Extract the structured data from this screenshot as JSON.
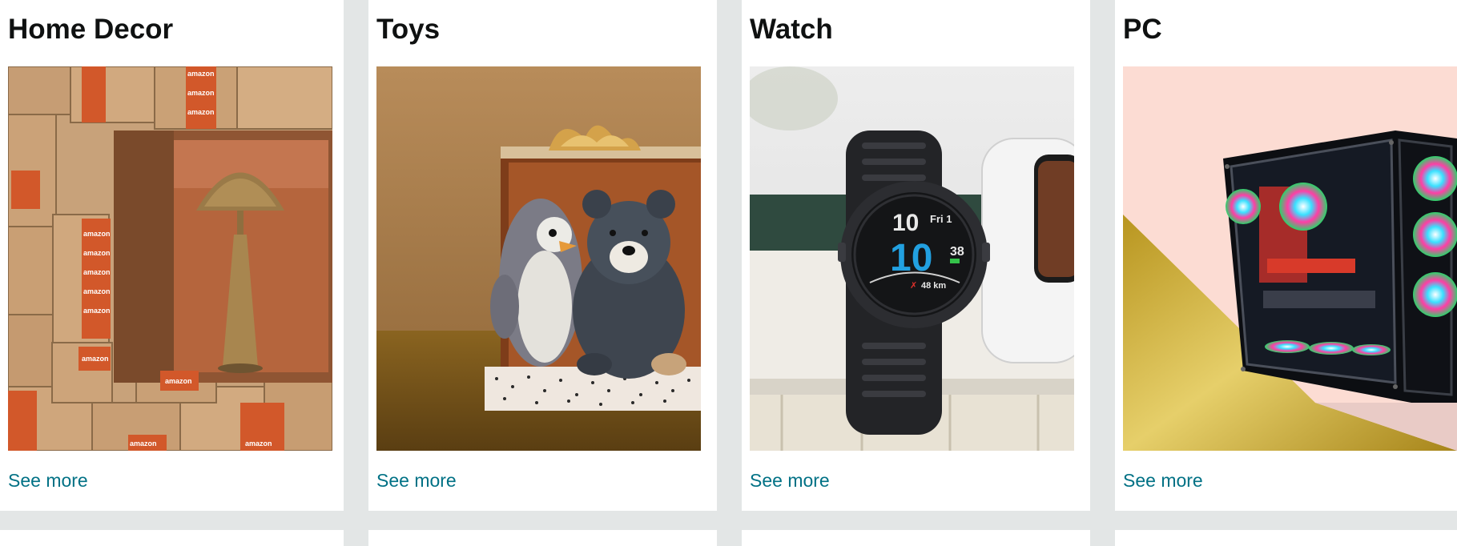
{
  "cards": [
    {
      "title": "Home Decor",
      "link": "See more",
      "image": "home-decor-image"
    },
    {
      "title": "Toys",
      "link": "See more",
      "image": "toys-image"
    },
    {
      "title": "Watch",
      "link": "See more",
      "image": "watch-image"
    },
    {
      "title": "PC",
      "link": "See more",
      "image": "pc-image"
    }
  ],
  "box_tape_text": "amazon",
  "watch_face": {
    "hour": "10",
    "minute": "10",
    "seconds": "38",
    "day": "Fri 1",
    "distance": "48 km"
  },
  "colors": {
    "link": "#007185",
    "title": "#0f1111",
    "page_background": "#e3e6e6",
    "card_background": "#ffffff"
  }
}
